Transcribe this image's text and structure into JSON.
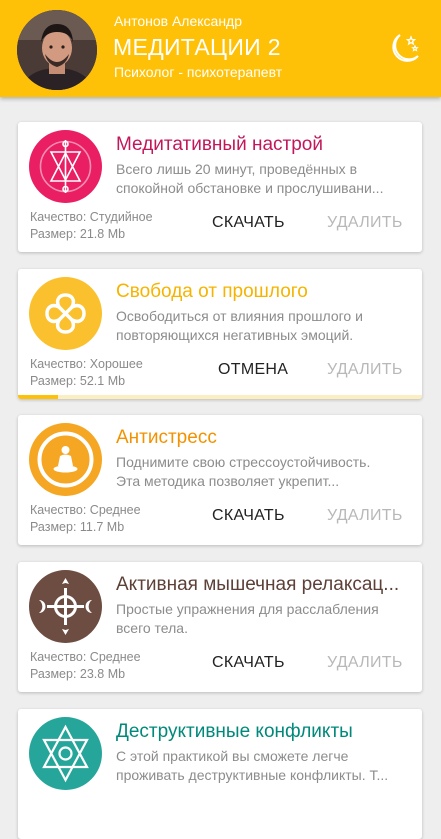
{
  "header": {
    "user_name": "Антонов Александр",
    "app_title": "МЕДИТАЦИИ 2",
    "subtitle": "Психолог - психотерапевт",
    "night_mode_icon": "moon-stars-icon"
  },
  "colors": {
    "header": "#ffc107",
    "card1_title": "#c2185b",
    "card1_icon": "#e91e63",
    "card2_title": "#f6b400",
    "card2_icon": "#fbc02d",
    "card3_title": "#f39200",
    "card3_icon": "#f5a623",
    "card4_title": "#5d4037",
    "card4_icon": "#6d4c41",
    "card5_title": "#00897b",
    "card5_icon": "#26a69a"
  },
  "cards": [
    {
      "title": "Медитативный настрой",
      "desc_line1": "Всего лишь 20 минут, проведённых в",
      "desc_line2": "спокойной обстановке и прослушивани...",
      "quality": "Качество: Студийное",
      "size": "Размер: 21.8 Mb",
      "action_label": "СКАЧАТЬ",
      "delete_label": "УДАЛИТЬ",
      "icon": "alchemy-symbol-icon"
    },
    {
      "title": "Свобода от прошлого",
      "desc_line1": "Освободиться от влияния прошлого и",
      "desc_line2": "повторяющихся негативных эмоций.",
      "quality": "Качество: Хорошее",
      "size": "Размер: 52.1 Mb",
      "action_label": "ОТМЕНА",
      "delete_label": "УДАЛИТЬ",
      "icon": "celtic-knot-icon",
      "download_progress": 0.1
    },
    {
      "title": "Антистресс",
      "desc_line1": "Поднимите свою стрессоустойчивость.",
      "desc_line2": "Эта методика позволяет укрепит...",
      "quality": "Качество: Среднее",
      "size": "Размер: 11.7 Mb",
      "action_label": "СКАЧАТЬ",
      "delete_label": "УДАЛИТЬ",
      "icon": "meditating-buddha-icon"
    },
    {
      "title": "Активная мышечная релаксац...",
      "desc_line1": "Простые упражнения для расслабления",
      "desc_line2": "всего тела.",
      "quality": "Качество: Среднее",
      "size": "Размер: 23.8 Mb",
      "action_label": "СКАЧАТЬ",
      "delete_label": "УДАЛИТЬ",
      "icon": "moon-cross-icon"
    },
    {
      "title": "Деструктивные конфликты",
      "desc_line1": "С этой практикой вы сможете легче",
      "desc_line2": "проживать деструктивные конфликты. Т...",
      "icon": "unicursal-hexagram-icon"
    }
  ]
}
